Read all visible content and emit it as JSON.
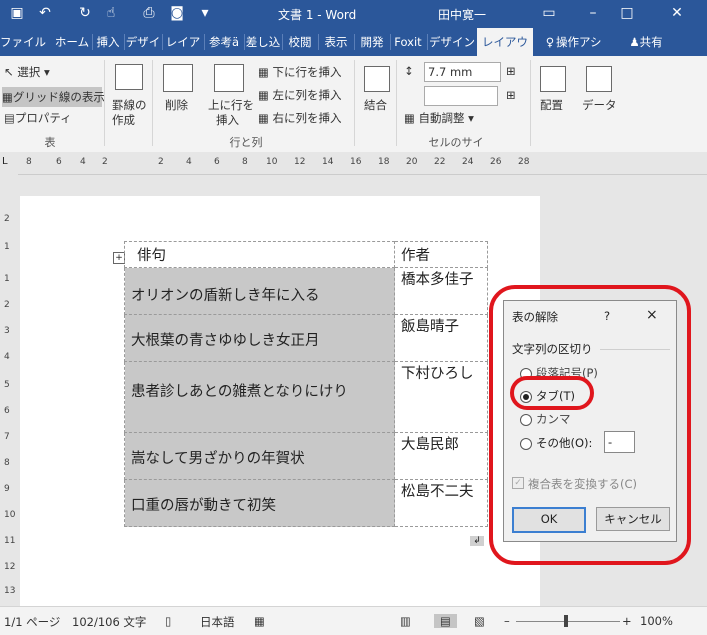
{
  "titlebar": {
    "doc_title": "文書 1 - Word",
    "user": "田中寛一"
  },
  "tabs": [
    "ファイル",
    "ホーム",
    "挿入",
    "デザイ",
    "レイア",
    "参考ä",
    "差し込",
    "校閲",
    "表示",
    "開発",
    "Foxit",
    "デザイン",
    "レイアウト",
    "操作アシス",
    "共有"
  ],
  "ribbon": {
    "select": "選択",
    "gridlines": "グリッド線の表示",
    "properties": "プロパティ",
    "group_table": "表",
    "draw_borders_1": "罫線の",
    "draw_borders_2": "作成",
    "delete": "削除",
    "insert_above_1": "上に行を",
    "insert_above_2": "挿入",
    "insert_below": "下に行を挿入",
    "insert_left": "左に列を挿入",
    "insert_right": "右に列を挿入",
    "group_rows_cols": "行と列",
    "merge": "結合",
    "height_value": "7.7 mm",
    "autofit": "自動調整",
    "group_cell_size": "セルのサイズ",
    "alignment": "配置",
    "data": "データ"
  },
  "ruler": [
    "8",
    "6",
    "4",
    "2",
    "2",
    "4",
    "6",
    "8",
    "10",
    "12",
    "14",
    "16",
    "18",
    "20",
    "22",
    "24",
    "26",
    "28"
  ],
  "vruler": [
    "2",
    "1",
    "1",
    "2",
    "3",
    "4",
    "5",
    "6",
    "7",
    "8",
    "9",
    "10",
    "11",
    "12",
    "13"
  ],
  "table": {
    "header": [
      "俳句",
      "作者"
    ],
    "rows": [
      {
        "haiku": "オリオンの盾新しき年に入る",
        "author": "橋本多佳子"
      },
      {
        "haiku": "大根葉の青さゆゆしき女正月",
        "author": "飯島晴子"
      },
      {
        "haiku": "患者診しあとの雑煮となりにけり",
        "author": "下村ひろし"
      },
      {
        "haiku": "嵩なして男ざかりの年賀状",
        "author": "大島民郎"
      },
      {
        "haiku": "口重の唇が動きて初笑",
        "author": "松島不二夫"
      }
    ]
  },
  "dialog": {
    "title": "表の解除",
    "help": "?",
    "close": "×",
    "section": "文字列の区切り",
    "opt_paragraph": "段落記号(P)",
    "opt_tab": "タブ(T)",
    "opt_comma": "カンマ",
    "opt_other": "その他(O):",
    "other_value": "-",
    "nested": "複合表を変換する(C)",
    "ok": "OK",
    "cancel": "キャンセル"
  },
  "status": {
    "page": "1/1 ページ",
    "words": "102/106 文字",
    "lang": "日本語",
    "zoom": "100%"
  },
  "colors": {
    "brand": "#2b579a",
    "highlight_ring": "#e0161d"
  }
}
